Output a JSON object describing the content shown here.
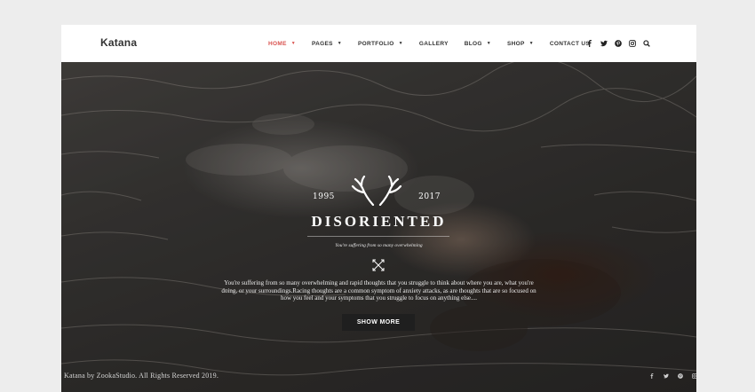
{
  "site": {
    "logo": "Katana"
  },
  "nav": {
    "items": [
      {
        "label": "HOME",
        "dropdown": true,
        "active": true
      },
      {
        "label": "PAGES",
        "dropdown": true
      },
      {
        "label": "PORTFOLIO",
        "dropdown": true
      },
      {
        "label": "GALLERY",
        "dropdown": false
      },
      {
        "label": "BLOG",
        "dropdown": true
      },
      {
        "label": "SHOP",
        "dropdown": true
      },
      {
        "label": "CONTACT US",
        "dropdown": false
      }
    ],
    "social_icons": [
      "facebook-icon",
      "twitter-icon",
      "pinterest-icon",
      "instagram-icon",
      "search-icon"
    ]
  },
  "hero": {
    "year_start": "1995",
    "year_end": "2017",
    "emblem_icon": "antlers-icon",
    "title": "DISORIENTED",
    "tagline": "You're suffering from so many overwhelming",
    "divider_icon": "crossed-arrows-icon",
    "description": "You're suffering from so many overwhelming and rapid thoughts that you struggle to think about where you are, what you're doing, or your surroundings.Racing thoughts are a common symptom of anxiety attacks, as are thoughts that are so focused on how you feel and your symptoms that you struggle to focus on anything else....",
    "button_label": "SHOW MORE"
  },
  "footer": {
    "copyright": "Katana by ZookaStudio. All Rights Reserved 2019.",
    "social_icons": [
      "facebook-icon",
      "twitter-icon",
      "pinterest-icon",
      "instagram-icon"
    ]
  },
  "colors": {
    "accent": "#d9534f",
    "header_bg": "#ffffff",
    "button_bg": "#1f1f1f",
    "page_bg": "#ededed"
  }
}
